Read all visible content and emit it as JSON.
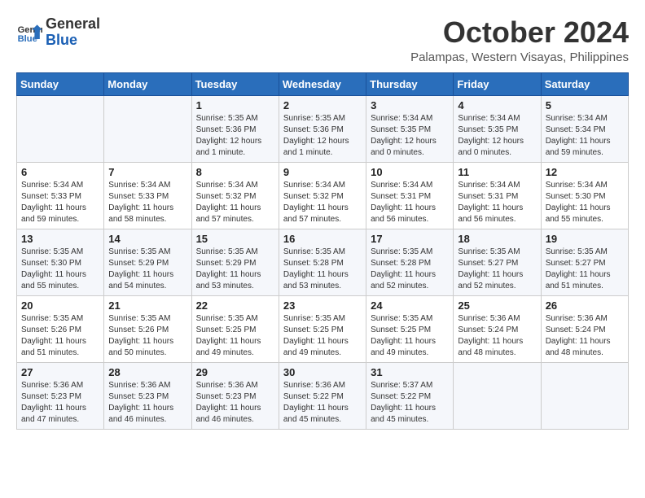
{
  "header": {
    "logo_line1": "General",
    "logo_line2": "Blue",
    "month": "October 2024",
    "location": "Palampas, Western Visayas, Philippines"
  },
  "weekdays": [
    "Sunday",
    "Monday",
    "Tuesday",
    "Wednesday",
    "Thursday",
    "Friday",
    "Saturday"
  ],
  "weeks": [
    [
      {
        "day": "",
        "info": ""
      },
      {
        "day": "",
        "info": ""
      },
      {
        "day": "1",
        "info": "Sunrise: 5:35 AM\nSunset: 5:36 PM\nDaylight: 12 hours\nand 1 minute."
      },
      {
        "day": "2",
        "info": "Sunrise: 5:35 AM\nSunset: 5:36 PM\nDaylight: 12 hours\nand 1 minute."
      },
      {
        "day": "3",
        "info": "Sunrise: 5:34 AM\nSunset: 5:35 PM\nDaylight: 12 hours\nand 0 minutes."
      },
      {
        "day": "4",
        "info": "Sunrise: 5:34 AM\nSunset: 5:35 PM\nDaylight: 12 hours\nand 0 minutes."
      },
      {
        "day": "5",
        "info": "Sunrise: 5:34 AM\nSunset: 5:34 PM\nDaylight: 11 hours\nand 59 minutes."
      }
    ],
    [
      {
        "day": "6",
        "info": "Sunrise: 5:34 AM\nSunset: 5:33 PM\nDaylight: 11 hours\nand 59 minutes."
      },
      {
        "day": "7",
        "info": "Sunrise: 5:34 AM\nSunset: 5:33 PM\nDaylight: 11 hours\nand 58 minutes."
      },
      {
        "day": "8",
        "info": "Sunrise: 5:34 AM\nSunset: 5:32 PM\nDaylight: 11 hours\nand 57 minutes."
      },
      {
        "day": "9",
        "info": "Sunrise: 5:34 AM\nSunset: 5:32 PM\nDaylight: 11 hours\nand 57 minutes."
      },
      {
        "day": "10",
        "info": "Sunrise: 5:34 AM\nSunset: 5:31 PM\nDaylight: 11 hours\nand 56 minutes."
      },
      {
        "day": "11",
        "info": "Sunrise: 5:34 AM\nSunset: 5:31 PM\nDaylight: 11 hours\nand 56 minutes."
      },
      {
        "day": "12",
        "info": "Sunrise: 5:34 AM\nSunset: 5:30 PM\nDaylight: 11 hours\nand 55 minutes."
      }
    ],
    [
      {
        "day": "13",
        "info": "Sunrise: 5:35 AM\nSunset: 5:30 PM\nDaylight: 11 hours\nand 55 minutes."
      },
      {
        "day": "14",
        "info": "Sunrise: 5:35 AM\nSunset: 5:29 PM\nDaylight: 11 hours\nand 54 minutes."
      },
      {
        "day": "15",
        "info": "Sunrise: 5:35 AM\nSunset: 5:29 PM\nDaylight: 11 hours\nand 53 minutes."
      },
      {
        "day": "16",
        "info": "Sunrise: 5:35 AM\nSunset: 5:28 PM\nDaylight: 11 hours\nand 53 minutes."
      },
      {
        "day": "17",
        "info": "Sunrise: 5:35 AM\nSunset: 5:28 PM\nDaylight: 11 hours\nand 52 minutes."
      },
      {
        "day": "18",
        "info": "Sunrise: 5:35 AM\nSunset: 5:27 PM\nDaylight: 11 hours\nand 52 minutes."
      },
      {
        "day": "19",
        "info": "Sunrise: 5:35 AM\nSunset: 5:27 PM\nDaylight: 11 hours\nand 51 minutes."
      }
    ],
    [
      {
        "day": "20",
        "info": "Sunrise: 5:35 AM\nSunset: 5:26 PM\nDaylight: 11 hours\nand 51 minutes."
      },
      {
        "day": "21",
        "info": "Sunrise: 5:35 AM\nSunset: 5:26 PM\nDaylight: 11 hours\nand 50 minutes."
      },
      {
        "day": "22",
        "info": "Sunrise: 5:35 AM\nSunset: 5:25 PM\nDaylight: 11 hours\nand 49 minutes."
      },
      {
        "day": "23",
        "info": "Sunrise: 5:35 AM\nSunset: 5:25 PM\nDaylight: 11 hours\nand 49 minutes."
      },
      {
        "day": "24",
        "info": "Sunrise: 5:35 AM\nSunset: 5:25 PM\nDaylight: 11 hours\nand 49 minutes."
      },
      {
        "day": "25",
        "info": "Sunrise: 5:36 AM\nSunset: 5:24 PM\nDaylight: 11 hours\nand 48 minutes."
      },
      {
        "day": "26",
        "info": "Sunrise: 5:36 AM\nSunset: 5:24 PM\nDaylight: 11 hours\nand 48 minutes."
      }
    ],
    [
      {
        "day": "27",
        "info": "Sunrise: 5:36 AM\nSunset: 5:23 PM\nDaylight: 11 hours\nand 47 minutes."
      },
      {
        "day": "28",
        "info": "Sunrise: 5:36 AM\nSunset: 5:23 PM\nDaylight: 11 hours\nand 46 minutes."
      },
      {
        "day": "29",
        "info": "Sunrise: 5:36 AM\nSunset: 5:23 PM\nDaylight: 11 hours\nand 46 minutes."
      },
      {
        "day": "30",
        "info": "Sunrise: 5:36 AM\nSunset: 5:22 PM\nDaylight: 11 hours\nand 45 minutes."
      },
      {
        "day": "31",
        "info": "Sunrise: 5:37 AM\nSunset: 5:22 PM\nDaylight: 11 hours\nand 45 minutes."
      },
      {
        "day": "",
        "info": ""
      },
      {
        "day": "",
        "info": ""
      }
    ]
  ]
}
